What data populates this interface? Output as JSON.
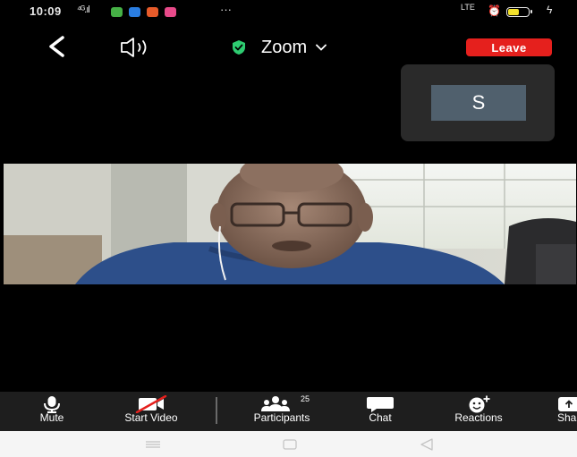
{
  "status_bar": {
    "time": "10:09",
    "signal": "⁴ᴳ.ıl",
    "more": "···",
    "network": "LTE",
    "battery_level": 0.55,
    "notification_colors": [
      "#46b146",
      "#2a7de1",
      "#e75b2a",
      "#e84a8a"
    ]
  },
  "top_bar": {
    "meeting_title": "Zoom",
    "leave_label": "Leave",
    "lock_color": "#2ecc71"
  },
  "self_view": {
    "initial": "S"
  },
  "toolbar": {
    "items": [
      {
        "label": "Mute",
        "icon": "microphone-icon"
      },
      {
        "label": "Start Video",
        "icon": "video-off-icon"
      },
      {
        "label": "Participants",
        "icon": "participants-icon",
        "count": "25"
      },
      {
        "label": "Chat",
        "icon": "chat-icon"
      },
      {
        "label": "Reactions",
        "icon": "reactions-icon"
      },
      {
        "label": "Sha",
        "icon": "share-icon"
      }
    ]
  },
  "colors": {
    "leave": "#e5201d",
    "toolbar_bg": "#1e1e1e",
    "avatar_bg": "#50606d"
  }
}
